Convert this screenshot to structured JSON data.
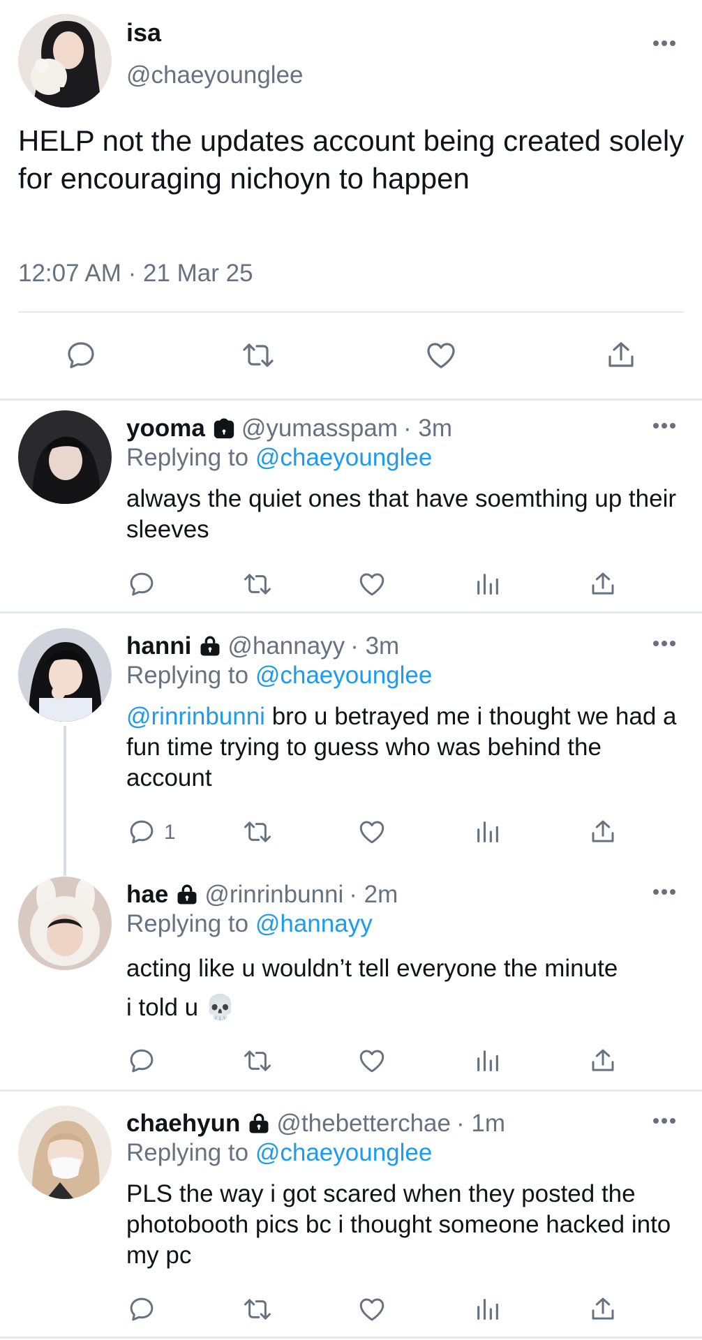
{
  "main_tweet": {
    "name": "isa",
    "handle": "@chaeyounglee",
    "text": "HELP not the updates account being created solely for encouraging nichoyn to happen",
    "timestamp": "12:07 AM · 21 Mar 25"
  },
  "replies": [
    {
      "name": "yooma",
      "handle": "@yumasspam",
      "time": "· 3m",
      "replying_prefix": "Replying to",
      "replying_to": "@chaeyounglee",
      "text": "always the quiet ones that have soemthing up their sleeves",
      "reply_count": ""
    },
    {
      "name": "hanni",
      "handle": "@hannayy",
      "time": "· 3m",
      "replying_prefix": "Replying to",
      "replying_to": "@chaeyounglee",
      "mention": "@rinrinbunni",
      "text": " bro u betrayed me i thought we had a fun time trying to guess who was behind the account",
      "reply_count": "1"
    },
    {
      "name": "hae",
      "handle": "@rinrinbunni",
      "time": "· 2m",
      "replying_prefix": "Replying to",
      "replying_to": "@hannayy",
      "text_line1": "acting like u wouldn’t tell everyone the minute",
      "text_line2": "i told u 💀",
      "reply_count": ""
    },
    {
      "name": "chaehyun",
      "handle": "@thebetterchae",
      "time": "· 1m",
      "replying_prefix": "Replying to",
      "replying_to": "@chaeyounglee",
      "text": "PLS the way i got scared when they posted the photobooth pics bc i thought someone hacked into my pc",
      "reply_count": ""
    }
  ],
  "icons": {
    "reply": "reply-icon",
    "retweet": "retweet-icon",
    "like": "heart-icon",
    "views": "views-icon",
    "share": "share-icon",
    "more": "more-icon",
    "lock": "lock-icon"
  },
  "colors": {
    "text": "#0f1419",
    "secondary": "#66727f",
    "link": "#1d9bf0",
    "divider": "#e6e9ec"
  }
}
